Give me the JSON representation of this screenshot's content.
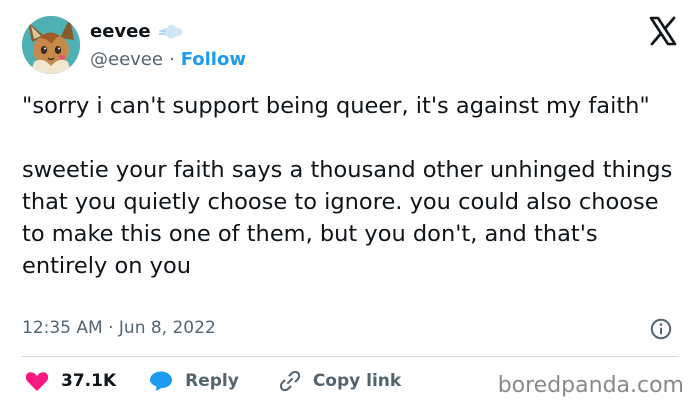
{
  "author": {
    "display_name": "eevee",
    "handle": "@eevee",
    "separator": "·",
    "follow_label": "Follow"
  },
  "tweet": {
    "paragraph_1": "\"sorry i can't support being queer, it's against my faith\"",
    "paragraph_2": "sweetie your faith says a thousand other unhinged things that you quietly choose to ignore.  you could also choose to make this one of them, but you don't, and that's entirely on you",
    "timestamp": "12:35 AM · Jun 8, 2022"
  },
  "actions": {
    "like_count": "37.1K",
    "reply_label": "Reply",
    "copy_link_label": "Copy link"
  },
  "watermark": "boredpanda.com",
  "icons": {
    "brand": "x-logo-icon",
    "badge": "cloud-puff-icon",
    "info": "info-icon",
    "like": "heart-icon",
    "reply": "speech-bubble-icon",
    "copy": "link-icon"
  },
  "colors": {
    "link_blue": "#1d9bf0",
    "heart_pink": "#f91880",
    "text_primary": "#0f1419",
    "text_secondary": "#536471",
    "avatar_bg": "#4fb0b3"
  }
}
